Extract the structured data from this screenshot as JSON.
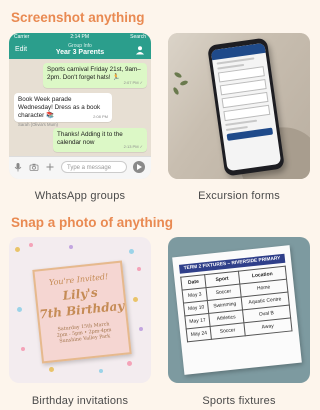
{
  "sections": {
    "screenshot_title": "Screenshot anything",
    "snap_title": "Snap a photo of anything"
  },
  "cards": {
    "whatsapp": {
      "caption": "WhatsApp groups",
      "status": {
        "carrier": "Carrier",
        "time": "2:14 PM",
        "search": "Search"
      },
      "header": {
        "edit": "Edit",
        "info": "Group Info",
        "name": "Year 3 Parents"
      },
      "messages": [
        {
          "text": "Sports carnival Friday 21st, 9am–2pm. Don't forget hats! 🏃",
          "time": "2:07 PM ✓"
        },
        {
          "text": "Book Week parade Wednesday! Dress as a book character 📚",
          "sender": "Sarah (Olivia's Mum)",
          "time": "2:08 PM"
        },
        {
          "text": "Thanks! Adding it to the calendar now",
          "time": "2:13 PM ✓"
        }
      ],
      "input_placeholder": "Type a message"
    },
    "excursion": {
      "caption": "Excursion forms"
    },
    "birthday": {
      "caption": "Birthday invitations",
      "line1": "You're Invited!",
      "line2": "Lily's",
      "line3": "7th Birthday",
      "details": [
        "Saturday 15th March",
        "2pm - 5pm • 2pm-4pm",
        "Sunshine Valley Park"
      ]
    },
    "sports": {
      "caption": "Sports fixtures",
      "heading": "TERM 2 FIXTURES – RIVERSIDE PRIMARY",
      "columns": [
        "Date",
        "Sport",
        "Location"
      ],
      "rows": [
        [
          "May 3",
          "Soccer",
          "Home"
        ],
        [
          "May 10",
          "Swimming",
          "Aquatic Centre"
        ],
        [
          "May 17",
          "Athletics",
          "Oval B"
        ],
        [
          "May 24",
          "Soccer",
          "Away"
        ]
      ]
    }
  },
  "colors": {
    "accent": "#e98a52",
    "whatsapp": "#2b9e8c",
    "bubble_out": "#dcf8c6"
  }
}
